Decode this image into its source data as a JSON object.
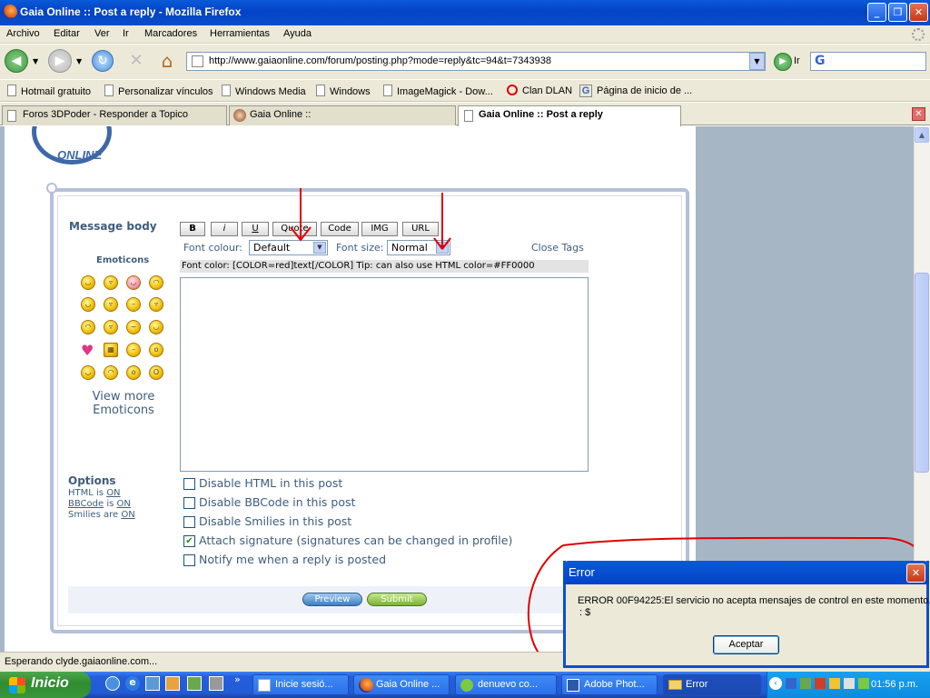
{
  "window": {
    "title": "Gaia Online :: Post a reply - Mozilla Firefox",
    "minimize": "_",
    "maximize": "❐",
    "close": "✕"
  },
  "menu": [
    "Archivo",
    "Editar",
    "Ver",
    "Ir",
    "Marcadores",
    "Herramientas",
    "Ayuda"
  ],
  "nav": {
    "url": "http://www.gaiaonline.com/forum/posting.php?mode=reply&tc=94&t=7343938",
    "go_label": "Ir",
    "search_engine": "G"
  },
  "bookmarks": [
    "Hotmail gratuito",
    "Personalizar vínculos",
    "Windows Media",
    "Windows",
    "ImageMagick - Dow...",
    "Clan DLAN",
    "Página de inicio de ..."
  ],
  "tabs": [
    "Foros 3DPoder - Responder a Topico",
    "Gaia Online ::",
    "Gaia Online :: Post a reply"
  ],
  "form": {
    "message_body_label": "Message body",
    "format_buttons": [
      "B",
      "i",
      "U",
      "Quote",
      "Code",
      "IMG",
      "URL"
    ],
    "font_colour_label": "Font colour:",
    "font_colour_value": "Default",
    "font_size_label": "Font size:",
    "font_size_value": "Normal",
    "close_tags": "Close Tags",
    "help_line": "Font color: [COLOR=red]text[/COLOR] Tip: can also use HTML color=#FF0000",
    "message_text": "",
    "emoticons_label": "Emoticons",
    "view_more_1": "View more",
    "view_more_2": "Emoticons",
    "options_label": "Options",
    "html_is": "HTML is",
    "html_state": "ON",
    "bbcode_link": "BBCode",
    "bbcode_is": "is",
    "bbcode_state": "ON",
    "smilies_are": "Smilies are",
    "smilies_state": "ON",
    "checkboxes": [
      {
        "label": "Disable HTML in this post",
        "checked": false
      },
      {
        "label": "Disable BBCode in this post",
        "checked": false
      },
      {
        "label": "Disable Smilies in this post",
        "checked": false
      },
      {
        "label": "Attach signature (signatures can be changed in profile)",
        "checked": true
      },
      {
        "label": "Notify me when a reply is posted",
        "checked": false
      }
    ],
    "preview": "Preview",
    "submit": "Submit"
  },
  "status_text": "Esperando clyde.gaiaonline.com...",
  "taskbar": {
    "start": "Inicio",
    "items": [
      "Inicie sesió...",
      "Gaia Online ...",
      "denuevo co...",
      "Adobe Phot...",
      "Error"
    ],
    "clock": "01:56 p.m."
  },
  "dialog": {
    "title": "Error",
    "message": "ERROR 00F94225:El servicio no acepta mensajes de control en este momento.",
    "message2": ": $",
    "button": "Aceptar"
  },
  "colors": {
    "xp_blue": "#0443c7",
    "label_blue": "#3e5d7e",
    "annotation_red": "#e00000"
  }
}
